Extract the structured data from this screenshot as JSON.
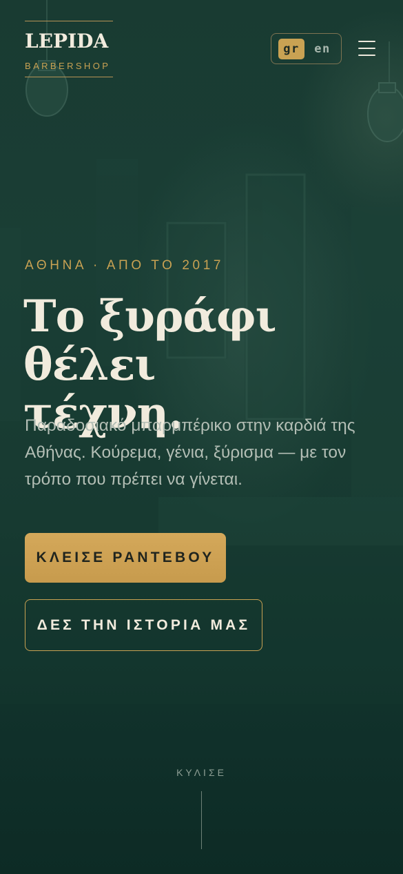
{
  "header": {
    "brand": "LEPIDA",
    "brand_sub": "BARBERSHOP",
    "languages": [
      {
        "code": "gr",
        "active": true
      },
      {
        "code": "en",
        "active": false
      }
    ],
    "menu_icon": "hamburger-menu-icon"
  },
  "hero": {
    "eyebrow": "ΑΘΗΝΑ · ΑΠΟ ΤΟ 2017",
    "headline_line1": "Το ξυράφι θέλει",
    "headline_line2": "τέχνη.",
    "lead": "Παραδοσιακό μπαρμπέρικο στην καρδιά της Αθήνας. Κούρεμα, γένια, ξύρισμα — με τον τρόπο που πρέπει να γίνεται.",
    "cta_primary": "ΚΛΕΙΣΕ ΡΑΝΤΕΒΟΥ",
    "cta_secondary": "ΔΕΣ ΤΗΝ ΙΣΤΟΡΙΑ ΜΑΣ",
    "scroll_hint": "ΚΥΛΙΣΕ"
  },
  "colors": {
    "background": "#173a31",
    "accent_gold": "#c9a253",
    "text_light": "#f1ebdd",
    "text_muted": "#b3beb5"
  }
}
